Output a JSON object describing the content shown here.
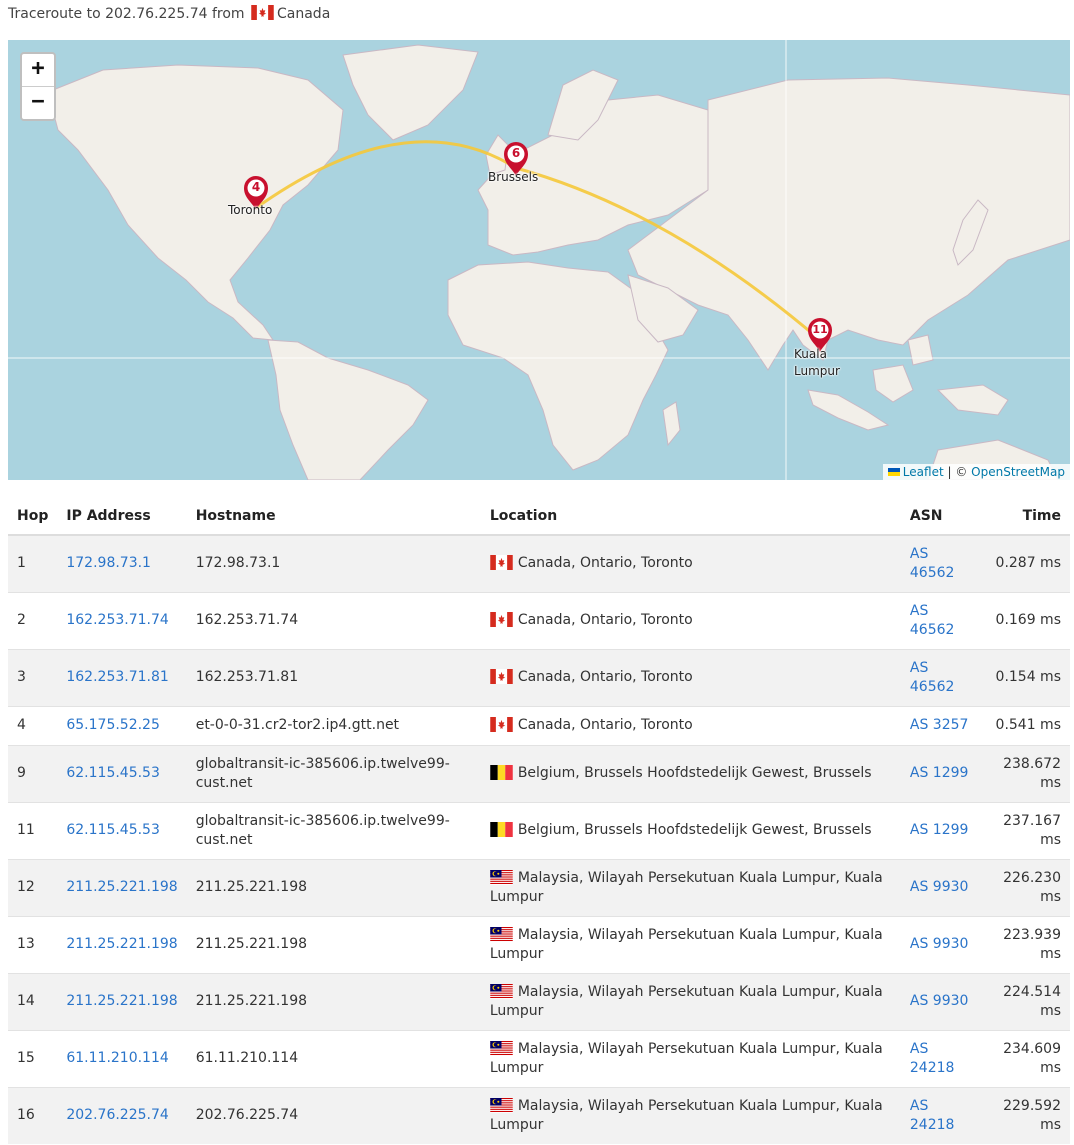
{
  "header": {
    "prefix": "Traceroute to 202.76.225.74 from",
    "country": "Canada",
    "flag": "canada"
  },
  "map": {
    "zoom_in": "+",
    "zoom_out": "−",
    "attribution": {
      "leaflet": "Leaflet",
      "separator": " | © ",
      "osm": "OpenStreetMap"
    },
    "markers": [
      {
        "number": "4",
        "label": "Toronto"
      },
      {
        "number": "6",
        "label": "Brussels"
      },
      {
        "number": "11",
        "label": "Kuala Lumpur"
      }
    ],
    "route_color": "#f5c83a",
    "marker_color": "#c8102e",
    "water_color": "#aad3df",
    "land_color": "#f2efe9"
  },
  "table": {
    "columns": {
      "hop": "Hop",
      "ip": "IP Address",
      "hostname": "Hostname",
      "location": "Location",
      "asn": "ASN",
      "time": "Time"
    },
    "rows": [
      {
        "hop": "1",
        "ip": "172.98.73.1",
        "hostname": "172.98.73.1",
        "flag": "canada",
        "location": "Canada, Ontario, Toronto",
        "asn": "AS 46562",
        "time": "0.287 ms"
      },
      {
        "hop": "2",
        "ip": "162.253.71.74",
        "hostname": "162.253.71.74",
        "flag": "canada",
        "location": "Canada, Ontario, Toronto",
        "asn": "AS 46562",
        "time": "0.169 ms"
      },
      {
        "hop": "3",
        "ip": "162.253.71.81",
        "hostname": "162.253.71.81",
        "flag": "canada",
        "location": "Canada, Ontario, Toronto",
        "asn": "AS 46562",
        "time": "0.154 ms"
      },
      {
        "hop": "4",
        "ip": "65.175.52.25",
        "hostname": "et-0-0-31.cr2-tor2.ip4.gtt.net",
        "flag": "canada",
        "location": "Canada, Ontario, Toronto",
        "asn": "AS 3257",
        "time": "0.541 ms"
      },
      {
        "hop": "9",
        "ip": "62.115.45.53",
        "hostname": "globaltransit-ic-385606.ip.twelve99-cust.net",
        "flag": "belgium",
        "location": "Belgium, Brussels Hoofdstedelijk Gewest, Brussels",
        "asn": "AS 1299",
        "time": "238.672 ms"
      },
      {
        "hop": "11",
        "ip": "62.115.45.53",
        "hostname": "globaltransit-ic-385606.ip.twelve99-cust.net",
        "flag": "belgium",
        "location": "Belgium, Brussels Hoofdstedelijk Gewest, Brussels",
        "asn": "AS 1299",
        "time": "237.167 ms"
      },
      {
        "hop": "12",
        "ip": "211.25.221.198",
        "hostname": "211.25.221.198",
        "flag": "malaysia",
        "location": "Malaysia, Wilayah Persekutuan Kuala Lumpur, Kuala Lumpur",
        "asn": "AS 9930",
        "time": "226.230 ms"
      },
      {
        "hop": "13",
        "ip": "211.25.221.198",
        "hostname": "211.25.221.198",
        "flag": "malaysia",
        "location": "Malaysia, Wilayah Persekutuan Kuala Lumpur, Kuala Lumpur",
        "asn": "AS 9930",
        "time": "223.939 ms"
      },
      {
        "hop": "14",
        "ip": "211.25.221.198",
        "hostname": "211.25.221.198",
        "flag": "malaysia",
        "location": "Malaysia, Wilayah Persekutuan Kuala Lumpur, Kuala Lumpur",
        "asn": "AS 9930",
        "time": "224.514 ms"
      },
      {
        "hop": "15",
        "ip": "61.11.210.114",
        "hostname": "61.11.210.114",
        "flag": "malaysia",
        "location": "Malaysia, Wilayah Persekutuan Kuala Lumpur, Kuala Lumpur",
        "asn": "AS 24218",
        "time": "234.609 ms"
      },
      {
        "hop": "16",
        "ip": "202.76.225.74",
        "hostname": "202.76.225.74",
        "flag": "malaysia",
        "location": "Malaysia, Wilayah Persekutuan Kuala Lumpur, Kuala Lumpur",
        "asn": "AS 24218",
        "time": "229.592 ms"
      }
    ]
  }
}
